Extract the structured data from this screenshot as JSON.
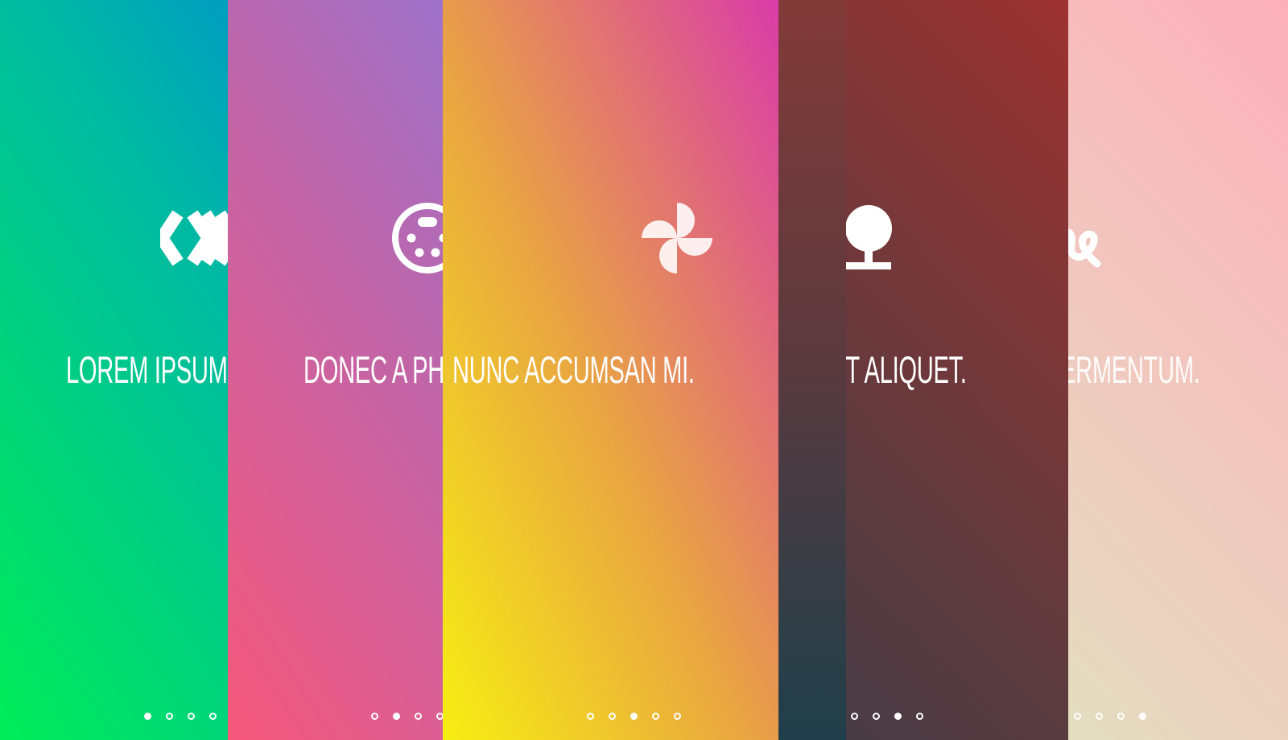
{
  "slides": [
    {
      "title": "LOREM IPSUM DOLOR SIT.",
      "icon": "code-icon",
      "active_dot": 1,
      "colors": [
        "#00ec58",
        "#00b8a5",
        "#0077e6"
      ]
    },
    {
      "title": "DONEC A PHARETRA.",
      "icon": "game-controller-icon",
      "active_dot": 2,
      "colors": [
        "#f6587c",
        "#c065a8",
        "#7a80ea"
      ]
    },
    {
      "title": "NUNC ACCUMSAN MI.",
      "icon": "pinwheel-icon",
      "active_dot": 3,
      "colors": [
        "#f6ef12",
        "#e9a641",
        "#d93ca8"
      ]
    },
    {
      "title": "SUSCIPIT ALIQUET.",
      "icon": "tree-icon",
      "active_dot": 4,
      "colors": [
        "#263d4f",
        "#5a3b40",
        "#9e3230"
      ]
    },
    {
      "title": "UT FERMENTUM.",
      "icon": "signature-icon",
      "active_dot": 5,
      "colors": [
        "#c8f7b6",
        "#e9d6c0",
        "#fdb0bc"
      ]
    }
  ]
}
